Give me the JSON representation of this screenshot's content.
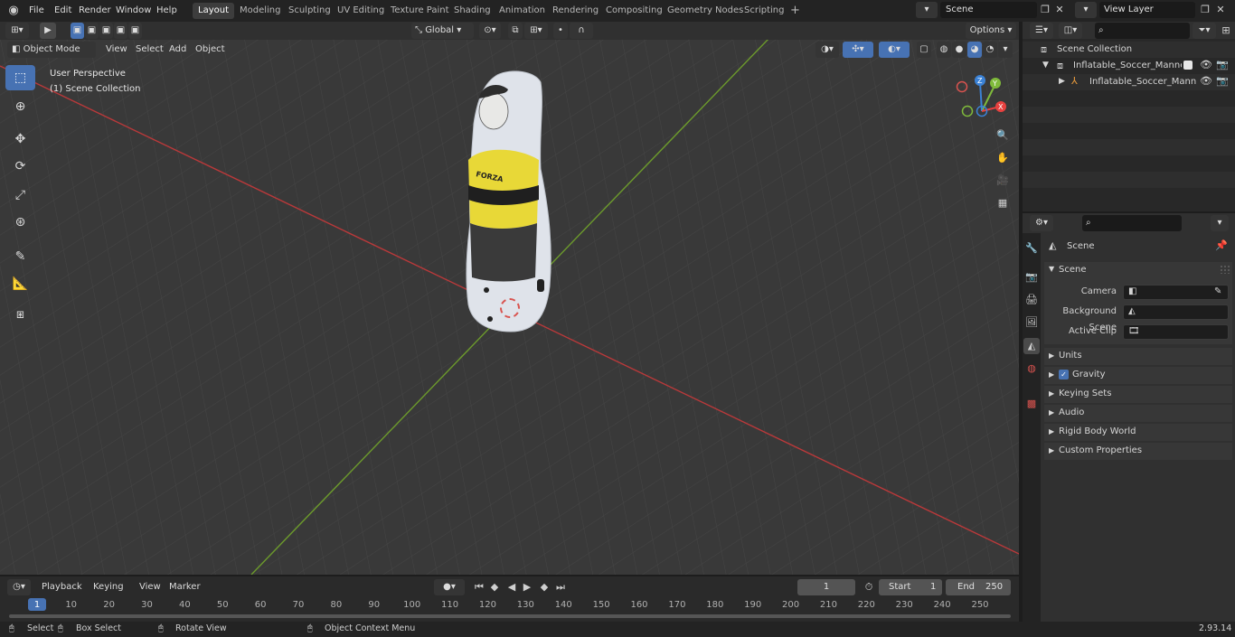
{
  "menu": [
    "File",
    "Edit",
    "Render",
    "Window",
    "Help"
  ],
  "workspaces": [
    "Layout",
    "Modeling",
    "Sculpting",
    "UV Editing",
    "Texture Paint",
    "Shading",
    "Animation",
    "Rendering",
    "Compositing",
    "Geometry Nodes",
    "Scripting"
  ],
  "active_workspace": "Layout",
  "add_workspace": "+",
  "scene_field": "Scene",
  "view_layer_field": "View Layer",
  "header": {
    "mode": "Object Mode",
    "menus": [
      "View",
      "Select",
      "Add",
      "Object"
    ],
    "transform_orientation": "Global",
    "options": "Options"
  },
  "overlay": {
    "perspective": "User Perspective",
    "collection": "(1) Scene Collection"
  },
  "gizmo": {
    "x": "X",
    "y": "Y",
    "z": "Z"
  },
  "outliner": {
    "root": "Scene Collection",
    "items": [
      "Inflatable_Soccer_Mannequin_",
      "Inflatable_Soccer_Manne"
    ]
  },
  "properties": {
    "context_title": "Scene",
    "panel_title": "Scene",
    "camera_label": "Camera",
    "bg_scene_label": "Background Scene",
    "active_clip_label": "Active Clip",
    "subpanels": [
      "Units",
      "Gravity",
      "Keying Sets",
      "Audio",
      "Rigid Body World",
      "Custom Properties"
    ]
  },
  "figure": {
    "shirt_text": "FORZA"
  },
  "timeline": {
    "menus": [
      "Playback",
      "Keying",
      "View",
      "Marker"
    ],
    "current_frame": "1",
    "start_label": "Start",
    "start_value": "1",
    "end_label": "End",
    "end_value": "250",
    "ticks": [
      "1",
      "10",
      "20",
      "30",
      "40",
      "50",
      "60",
      "70",
      "80",
      "90",
      "100",
      "110",
      "120",
      "130",
      "140",
      "150",
      "160",
      "170",
      "180",
      "190",
      "200",
      "210",
      "220",
      "230",
      "240",
      "250"
    ]
  },
  "status": {
    "select": "Select",
    "box_select": "Box Select",
    "rotate": "Rotate View",
    "context_menu": "Object Context Menu",
    "version": "2.93.14"
  },
  "colors": {
    "accent": "#4772b3",
    "x_axis": "#e8413f",
    "y_axis": "#7fba3b",
    "z_axis": "#3b82d6",
    "shirt": "#e8d837"
  }
}
